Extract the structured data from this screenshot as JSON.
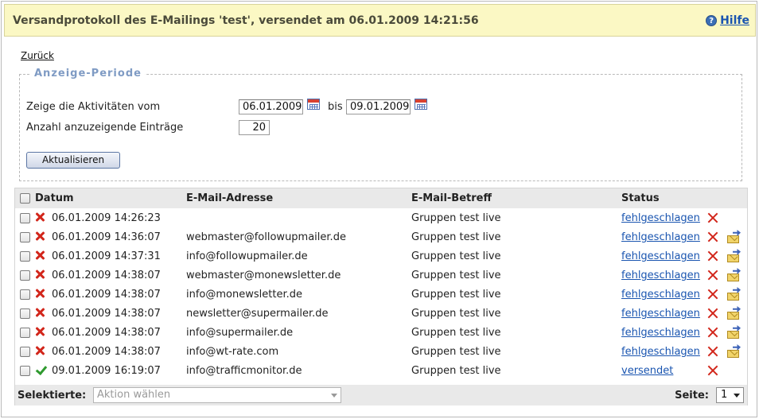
{
  "header": {
    "title": "Versandprotokoll des E-Mailings 'test', versendet am 06.01.2009 14:21:56",
    "help_label": "Hilfe",
    "help_icon": "help-icon"
  },
  "back_link": "Zurück",
  "period": {
    "legend": "Anzeige-Periode",
    "from_label": "Zeige die Aktivitäten vom",
    "from_date": "06.01.2009",
    "to_label": "bis",
    "to_date": "09.01.2009",
    "count_label": "Anzahl anzuzeigende Einträge",
    "count_value": "20",
    "update_button": "Aktualisieren"
  },
  "table": {
    "columns": [
      "Datum",
      "E-Mail-Adresse",
      "E-Mail-Betreff",
      "Status"
    ],
    "rows": [
      {
        "ok": false,
        "date": "06.01.2009 14:26:23",
        "email": "",
        "subject": "Gruppen test live",
        "status": "fehlgeschlagen",
        "resend": false
      },
      {
        "ok": false,
        "date": "06.01.2009 14:36:07",
        "email": "webmaster@followupmailer.de",
        "subject": "Gruppen test live",
        "status": "fehlgeschlagen",
        "resend": true
      },
      {
        "ok": false,
        "date": "06.01.2009 14:37:31",
        "email": "info@followupmailer.de",
        "subject": "Gruppen test live",
        "status": "fehlgeschlagen",
        "resend": true
      },
      {
        "ok": false,
        "date": "06.01.2009 14:38:07",
        "email": "webmaster@monewsletter.de",
        "subject": "Gruppen test live",
        "status": "fehlgeschlagen",
        "resend": true
      },
      {
        "ok": false,
        "date": "06.01.2009 14:38:07",
        "email": "info@monewsletter.de",
        "subject": "Gruppen test live",
        "status": "fehlgeschlagen",
        "resend": true
      },
      {
        "ok": false,
        "date": "06.01.2009 14:38:07",
        "email": "newsletter@supermailer.de",
        "subject": "Gruppen test live",
        "status": "fehlgeschlagen",
        "resend": true
      },
      {
        "ok": false,
        "date": "06.01.2009 14:38:07",
        "email": "info@supermailer.de",
        "subject": "Gruppen test live",
        "status": "fehlgeschlagen",
        "resend": true
      },
      {
        "ok": false,
        "date": "06.01.2009 14:38:07",
        "email": "info@wt-rate.com",
        "subject": "Gruppen test live",
        "status": "fehlgeschlagen",
        "resend": true
      },
      {
        "ok": true,
        "date": "09.01.2009 16:19:07",
        "email": "info@trafficmonitor.de",
        "subject": "Gruppen test live",
        "status": "versendet",
        "resend": false
      }
    ]
  },
  "footer": {
    "selected_label": "Selektierte:",
    "action_placeholder": "Aktion wählen",
    "page_label": "Seite:",
    "page_value": "1"
  },
  "colors": {
    "header_bg": "#fbf8c4",
    "link": "#1a55b0",
    "failed_icon": "#d2261b",
    "success_icon": "#2f9a2f",
    "legend": "#7f9bc4"
  }
}
